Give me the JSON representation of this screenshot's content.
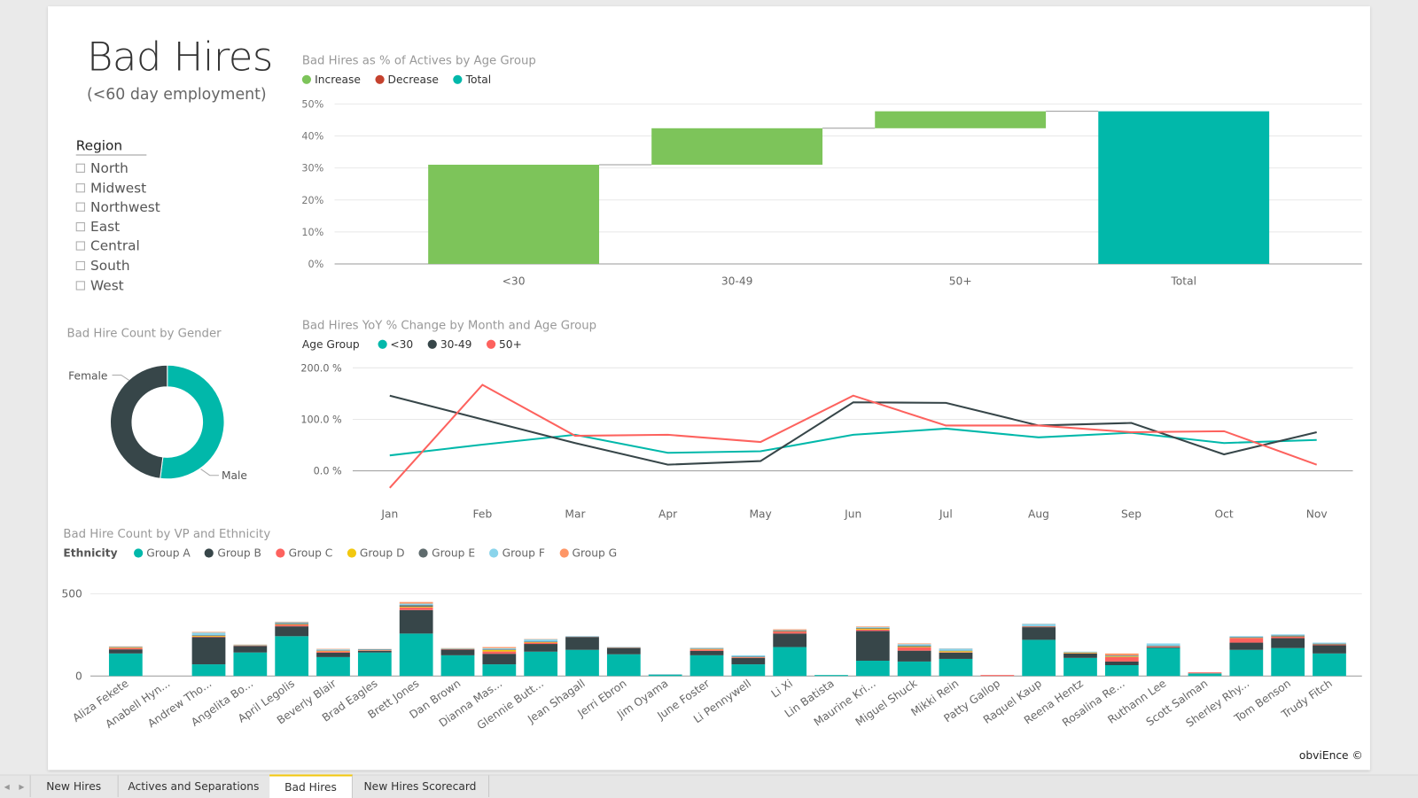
{
  "header": {
    "title": "Bad Hires",
    "subtitle": "(<60 day employment)"
  },
  "region_slicer": {
    "title": "Region",
    "items": [
      "North",
      "Midwest",
      "Northwest",
      "East",
      "Central",
      "South",
      "West"
    ]
  },
  "colors": {
    "increase": "#7dc45a",
    "decrease": "#c5422e",
    "total": "#01b8aa",
    "lt30": "#01b8aa",
    "mid": "#374649",
    "gt50": "#fd625e",
    "groups": [
      "#01b8aa",
      "#374649",
      "#fd625e",
      "#f2c80f",
      "#5f6b6d",
      "#8ad4eb",
      "#fe9666"
    ]
  },
  "chart_data": [
    {
      "type": "waterfall",
      "title": "Bad Hires as % of Actives by Age Group",
      "legend": [
        "Increase",
        "Decrease",
        "Total"
      ],
      "categories": [
        "<30",
        "30-49",
        "50+",
        "Total"
      ],
      "values": [
        31.0,
        11.4,
        5.3,
        47.7
      ],
      "kinds": [
        "increase",
        "increase",
        "increase",
        "total"
      ],
      "yticks": [
        "0%",
        "10%",
        "20%",
        "30%",
        "40%",
        "50%"
      ],
      "ylim": [
        0,
        50
      ],
      "unit": "%"
    },
    {
      "type": "line",
      "title": "Bad Hires YoY % Change by Month and Age Group",
      "legend_title": "Age Group",
      "x": [
        "Jan",
        "Feb",
        "Mar",
        "Apr",
        "May",
        "Jun",
        "Jul",
        "Aug",
        "Sep",
        "Oct",
        "Nov"
      ],
      "series": [
        {
          "name": "<30",
          "values": [
            30,
            51,
            70,
            35,
            38,
            70,
            82,
            65,
            74,
            54,
            60
          ]
        },
        {
          "name": "30-49",
          "values": [
            146,
            100,
            54,
            12,
            19,
            133,
            132,
            88,
            93,
            32,
            75
          ]
        },
        {
          "name": "50+",
          "values": [
            -33,
            167,
            68,
            70,
            56,
            146,
            88,
            88,
            75,
            77,
            12
          ]
        }
      ],
      "yticks": [
        "0.0 %",
        "100.0 %",
        "200.0 %"
      ],
      "ylim": [
        -40,
        200
      ]
    },
    {
      "type": "pie",
      "title": "Bad Hire Count by Gender",
      "labels": [
        "Male",
        "Female"
      ],
      "values": [
        52,
        48
      ]
    },
    {
      "type": "bar",
      "stacked": true,
      "title": "Bad Hire Count by VP and Ethnicity",
      "legend_title": "Ethnicity",
      "series_names": [
        "Group A",
        "Group B",
        "Group C",
        "Group D",
        "Group E",
        "Group F",
        "Group G"
      ],
      "yticks": [
        "0",
        "500"
      ],
      "ylim": [
        0,
        500
      ],
      "categories": [
        "Aliza Fekete",
        "Anabell Hyn...",
        "Andrew Tho...",
        "Angelita Bo...",
        "April Legolis",
        "Beverly Blair",
        "Brad Eagles",
        "Brett Jones",
        "Dan Brown",
        "Dianna Mas...",
        "Glennie Butt...",
        "Jean Shagall",
        "Jerri Ebron",
        "Jim Oyama",
        "June Foster",
        "Li Pennywell",
        "Li Xi",
        "Lin Batista",
        "Maurine Kri...",
        "Miguel Shuck",
        "Mikki Rein",
        "Patty Gallop",
        "Raquel Kaup",
        "Reena Hentz",
        "Rosalina Re...",
        "Ruthann Lee",
        "Scott Salman",
        "Sherley Rhy...",
        "Tom Benson",
        "Trudy Fitch"
      ],
      "values": [
        [
          137,
          25,
          8,
          3,
          3,
          2,
          2
        ],
        [
          0,
          0,
          0,
          0,
          0,
          0,
          0
        ],
        [
          71,
          165,
          4,
          4,
          4,
          16,
          4
        ],
        [
          143,
          40,
          3,
          1,
          1,
          3,
          1
        ],
        [
          242,
          60,
          10,
          3,
          6,
          6,
          3
        ],
        [
          115,
          27,
          8,
          3,
          3,
          6,
          3
        ],
        [
          143,
          10,
          3,
          1,
          4,
          3,
          1
        ],
        [
          258,
          143,
          16,
          4,
          10,
          9,
          10
        ],
        [
          126,
          35,
          3,
          1,
          1,
          3,
          1
        ],
        [
          71,
          64,
          14,
          9,
          4,
          7,
          7
        ],
        [
          148,
          47,
          8,
          3,
          3,
          14,
          2
        ],
        [
          159,
          77,
          1,
          0,
          3,
          2,
          0
        ],
        [
          132,
          38,
          1,
          1,
          3,
          1,
          0
        ],
        [
          8,
          0,
          0,
          0,
          1,
          2,
          0
        ],
        [
          126,
          27,
          8,
          3,
          3,
          4,
          1
        ],
        [
          71,
          38,
          4,
          1,
          4,
          8,
          0
        ],
        [
          176,
          82,
          12,
          2,
          4,
          3,
          5
        ],
        [
          6,
          0,
          0,
          0,
          0,
          0,
          0
        ],
        [
          93,
          181,
          8,
          6,
          4,
          5,
          4
        ],
        [
          88,
          66,
          20,
          4,
          6,
          10,
          4
        ],
        [
          104,
          38,
          3,
          6,
          3,
          13,
          1
        ],
        [
          0,
          0,
          6,
          0,
          0,
          0,
          0
        ],
        [
          220,
          77,
          3,
          1,
          2,
          14,
          1
        ],
        [
          110,
          27,
          2,
          4,
          1,
          4,
          0
        ],
        [
          66,
          22,
          27,
          4,
          4,
          2,
          12
        ],
        [
          170,
          5,
          4,
          1,
          4,
          14,
          0
        ],
        [
          16,
          0,
          6,
          0,
          0,
          0,
          0
        ],
        [
          159,
          44,
          27,
          2,
          4,
          6,
          0
        ],
        [
          170,
          60,
          8,
          2,
          6,
          7,
          0
        ],
        [
          137,
          50,
          4,
          1,
          5,
          6,
          0
        ]
      ]
    }
  ],
  "footer": {
    "brand": "obviEnce ©"
  },
  "tabs": {
    "items": [
      "New Hires",
      "Actives and Separations",
      "Bad Hires",
      "New Hires Scorecard"
    ],
    "active": "Bad Hires",
    "prev": "◂",
    "next": "▸"
  }
}
